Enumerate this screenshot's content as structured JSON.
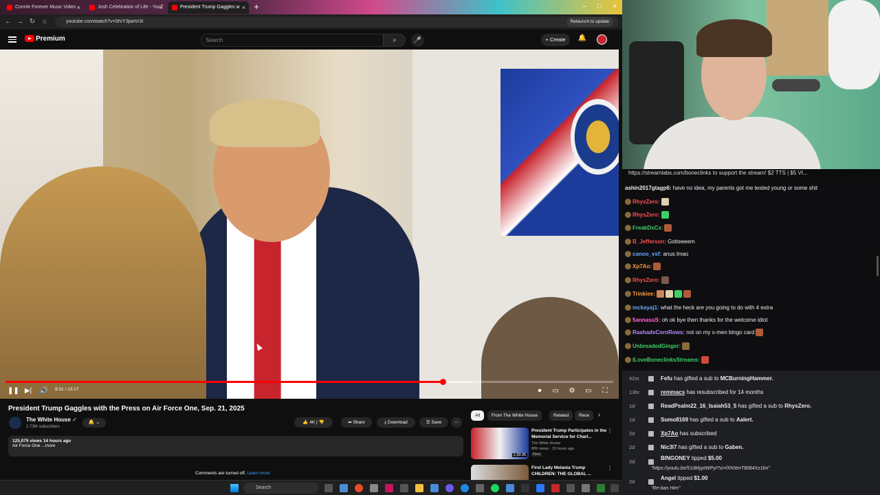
{
  "browser": {
    "tabs": [
      {
        "label": "Connie Forever Music Video -"
      },
      {
        "label": "Josh Celebration of Life - YouT"
      },
      {
        "label": "President Trump Gaggles w"
      }
    ],
    "url": "youtube.com/watch?v=0tVY3pwVr3I",
    "relaunch_label": "Relaunch to update"
  },
  "youtube": {
    "logo_label": "Premium",
    "search_placeholder": "Search",
    "create_label": "Create",
    "video": {
      "timecode": "9:31 / 13:17",
      "progress": 0.72,
      "buffered": 0.77,
      "title": "President Trump Gaggles with the Press on Air Force One, Sep. 21, 2025",
      "channel": "The White House",
      "subscribers": "2.73M subscribers",
      "likes": "4K",
      "share_label": "Share",
      "download_label": "Download",
      "save_label": "Save",
      "views_line": "125,075 views  14 hours ago",
      "desc_line": "Air Force One ...more",
      "comments_off": "Comments are turned off.",
      "learn_more": "Learn more"
    },
    "chips": [
      "All",
      "From The White House",
      "Related",
      "Rece"
    ],
    "recommendations": [
      {
        "title": "President Trump Participates in the Memorial Service for Charl...",
        "channel": "The White House",
        "views": "80K views · 15 hours ago",
        "badge": "New",
        "duration": "1:39:35"
      },
      {
        "title": "First Lady Melania Trump CHILDREN: THE GLOBAL ...",
        "channel": "",
        "views": "",
        "badge": "",
        "duration": ""
      }
    ]
  },
  "taskbar": {
    "search_placeholder": "Search"
  },
  "stream": {
    "overlay_text": "https://streamlabs.com/boneclinks to support the stream! $2 TTS | $5 VI...",
    "chat": [
      {
        "user": "ashin2017gtagp6:",
        "text": "have no idea, my parents got me tested young or some shit",
        "color": "#efeff1"
      },
      {
        "user": "RhysZero:",
        "text": "",
        "color": "#ff4f4f"
      },
      {
        "user": "RhysZero:",
        "text": "",
        "color": "#ff4f4f"
      },
      {
        "user": "FreakDxCx:",
        "text": "",
        "color": "#3ecf6a"
      },
      {
        "user": "B_Jefferson:",
        "text": "Gotteeeem",
        "color": "#ff4f4f"
      },
      {
        "user": "canoo_vsf:",
        "text": "anus lmao",
        "color": "#6aa9ff"
      },
      {
        "user": "Xp7Ao:",
        "text": "",
        "color": "#ff9a3c"
      },
      {
        "user": "RhysZero:",
        "text": "",
        "color": "#ff4f4f"
      },
      {
        "user": "Trinkiee:",
        "text": "",
        "color": "#ff9a3c"
      },
      {
        "user": "mckayaj1:",
        "text": "what the heck are you going to do with 4 extra",
        "color": "#6aa9ff"
      },
      {
        "user": "5annasuS:",
        "text": "oh ok bye then thanks for the welcome idiot",
        "color": "#ff6ad5"
      },
      {
        "user": "RashadsCornRows:",
        "text": "not on my x-men bingo card",
        "color": "#b58cff"
      },
      {
        "user": "UnbreadedGinger:",
        "text": "",
        "color": "#3ecf6a"
      },
      {
        "user": "ILoveBoneclinksStreams:",
        "text": "",
        "color": "#3ecf6a"
      }
    ],
    "events": [
      {
        "time": "42m",
        "pre": "Fefu",
        "mid": " has gifted a sub to ",
        "post": "MCBurningHammer."
      },
      {
        "time": "13hr",
        "pre": "remmacs",
        "mid": " has resubscribed for 14 months",
        "post": ""
      },
      {
        "time": "1d",
        "pre": "ReadPsalm22_16_Isaiah53_5",
        "mid": " has gifted a sub to ",
        "post": "RhysZero."
      },
      {
        "time": "1d",
        "pre": "Sumo8169",
        "mid": " has gifted a sub to ",
        "post": "Aalert."
      },
      {
        "time": "2d",
        "pre": "Xp7Ao",
        "mid": " has subscribed",
        "post": ""
      },
      {
        "time": "2d",
        "pre": "Nic3l7",
        "mid": " has gifted a sub to ",
        "post": "Gaben."
      },
      {
        "time": "2d",
        "pre": "BINGONEY",
        "mid": " tipped ",
        "post": "$5.00",
        "sub": "\"https://youtu.be/51dMyptWPyI?si=fXh5tmTBIB4Xz1bn\""
      },
      {
        "time": "2d",
        "pre": "Angel",
        "mid": " tipped ",
        "post": "$1.00",
        "sub": "\"Re-ban Him\""
      }
    ]
  }
}
